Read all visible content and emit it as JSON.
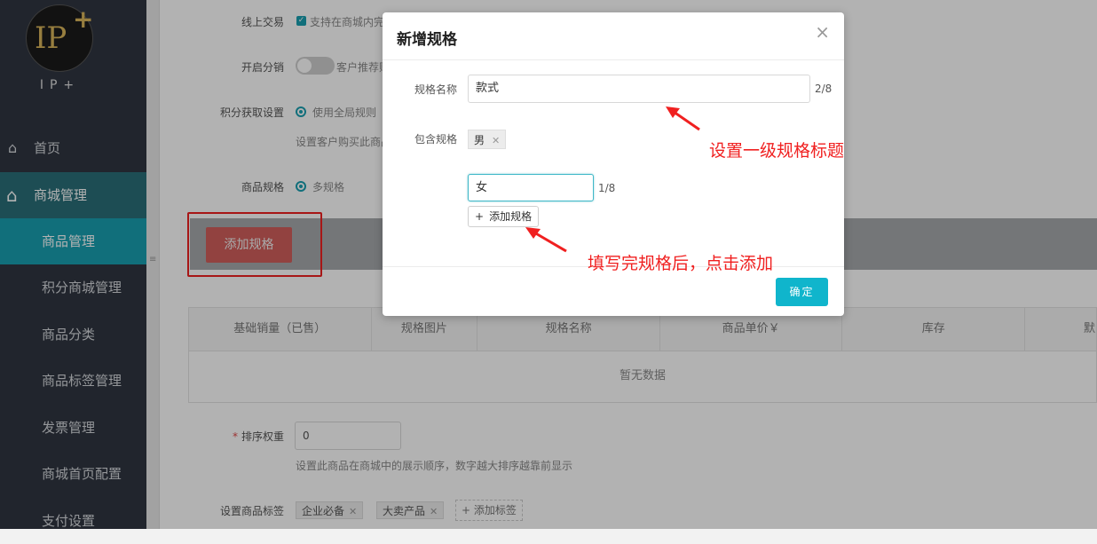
{
  "logo": {
    "mark": "IP",
    "plus": "+",
    "text": "IP+"
  },
  "sidebar": {
    "items": [
      {
        "label": "首页",
        "icon": "home-icon"
      },
      {
        "label": "商城管理",
        "icon": "home-icon"
      },
      {
        "label": "商品管理"
      },
      {
        "label": "积分商城管理"
      },
      {
        "label": "商品分类"
      },
      {
        "label": "商品标签管理"
      },
      {
        "label": "发票管理"
      },
      {
        "label": "商城首页配置"
      },
      {
        "label": "支付设置"
      }
    ]
  },
  "splitter": {
    "handle": "≡"
  },
  "form": {
    "online_trade_label": "线上交易",
    "online_trade_text": "支持在商城内完",
    "distribution_label": "开启分销",
    "distribution_text": "客户推荐购",
    "points_label": "积分获取设置",
    "points_option": "使用全局规则",
    "points_hint": "设置客户购买此商品",
    "spec_label": "商品规格",
    "spec_option": "多规格",
    "add_spec_button": "添加规格",
    "sort_label": "排序权重",
    "sort_required": "*",
    "sort_value": "0",
    "sort_hint": "设置此商品在商城中的展示顺序，数字越大排序越靠前显示",
    "tags_label": "设置商品标签",
    "tags": [
      "企业必备",
      "大卖产品"
    ],
    "add_tag": "添加标签"
  },
  "table": {
    "headers": [
      "基础销量（已售）",
      "规格图片",
      "规格名称",
      "商品单价￥",
      "库存",
      "默"
    ],
    "empty_text": "暂无数据"
  },
  "modal": {
    "title": "新增规格",
    "close": "×",
    "name_label": "规格名称",
    "name_value": "款式",
    "name_count": "2/8",
    "includes_label": "包含规格",
    "existing_tag": "男",
    "new_value": "女",
    "new_count": "1/8",
    "add_button": "添加规格",
    "confirm_button": "确定"
  },
  "annotations": {
    "title_note": "设置一级规格标题",
    "add_note": "填写完规格后，点击添加"
  },
  "colors": {
    "sidebar": "#303641",
    "accent": "#199fb0",
    "annotation": "#f02020",
    "confirm": "#10b5cc"
  }
}
